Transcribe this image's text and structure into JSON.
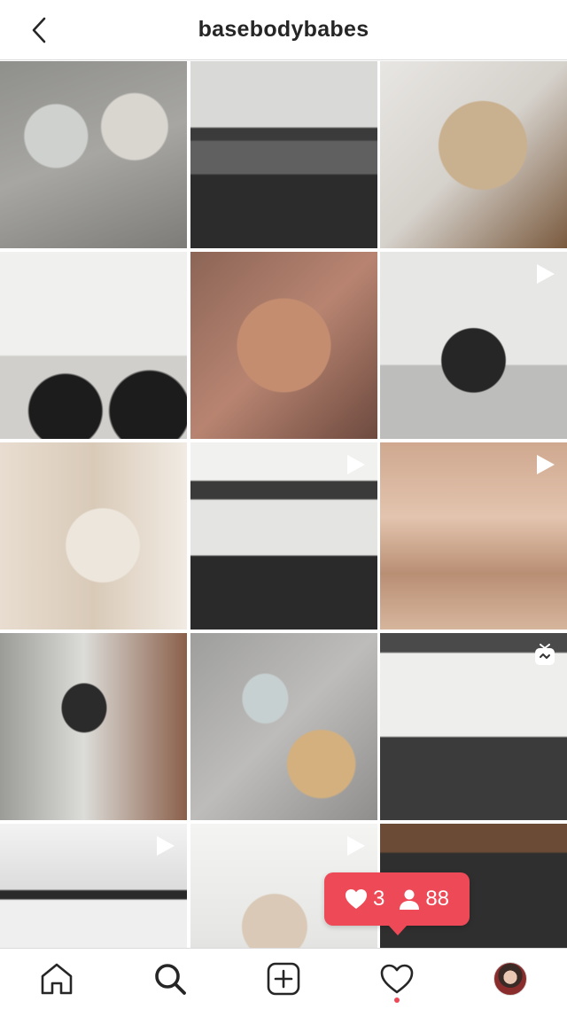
{
  "header": {
    "title": "basebodybabes"
  },
  "grid": {
    "tiles": [
      {
        "type": "photo"
      },
      {
        "type": "photo"
      },
      {
        "type": "photo"
      },
      {
        "type": "photo"
      },
      {
        "type": "photo"
      },
      {
        "type": "video"
      },
      {
        "type": "photo"
      },
      {
        "type": "video"
      },
      {
        "type": "video"
      },
      {
        "type": "photo"
      },
      {
        "type": "photo"
      },
      {
        "type": "igtv"
      },
      {
        "type": "video"
      },
      {
        "type": "video"
      },
      {
        "type": "photo"
      }
    ]
  },
  "activity_popup": {
    "likes": "3",
    "followers": "88",
    "color": "#ed4956"
  },
  "bottom_nav": {
    "items": [
      "home-icon",
      "search-icon",
      "new-post-icon",
      "activity-icon",
      "profile-avatar"
    ],
    "active_notification": true
  }
}
